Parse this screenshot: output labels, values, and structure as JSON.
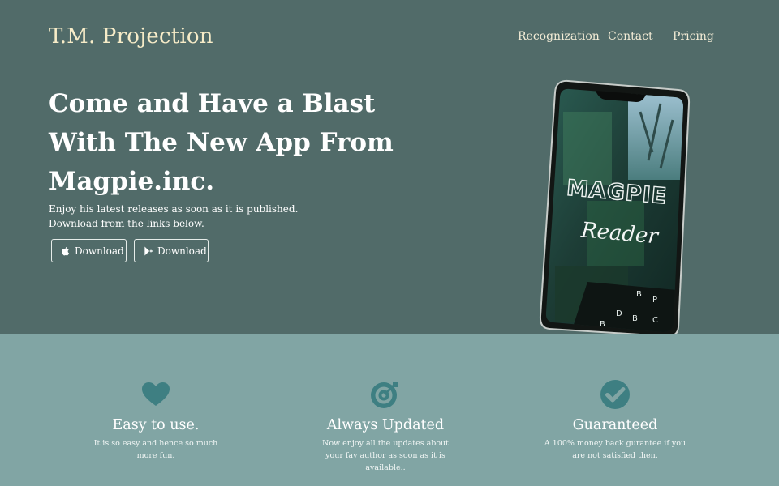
{
  "brand": "T.M. Projection",
  "nav": [
    "Recognization",
    "Contact",
    "Pricing"
  ],
  "hero": {
    "headline": "Come and Have a Blast With The New App From Magpie.inc.",
    "subtext_line1": "Enjoy his latest releases as soon as it is published.",
    "subtext_line2": "Download from the links below.",
    "buttons": [
      {
        "label": "Download",
        "icon": "apple-icon"
      },
      {
        "label": "Download",
        "icon": "play-store-icon"
      }
    ],
    "phone_screen": {
      "title": "MAGPIE",
      "subtitle": "Reader"
    }
  },
  "features": [
    {
      "icon": "heart-icon",
      "title": "Easy to use.",
      "desc": "It is so easy and hence so much more fun."
    },
    {
      "icon": "bullseye-icon",
      "title": "Always Updated",
      "desc": "Now enjoy all the updates about your fav author as soon as it is available.."
    },
    {
      "icon": "check-circle-icon",
      "title": "Guaranteed",
      "desc": "A 100% money back gurantee if you are not satisfied then."
    }
  ],
  "colors": {
    "hero_bg": "#516b69",
    "features_bg": "#81a5a4",
    "brand_text": "#f7ecc8",
    "icon_teal": "#3e7f82"
  }
}
